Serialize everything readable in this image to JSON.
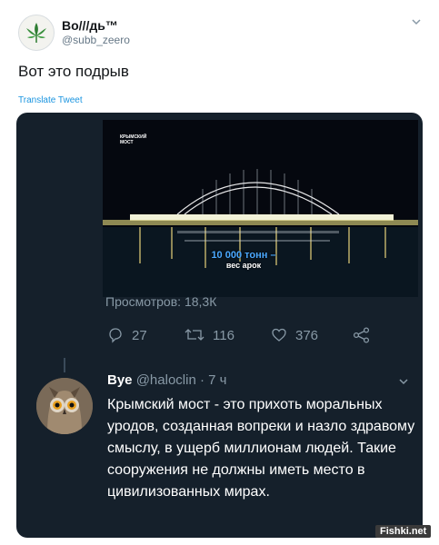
{
  "author": {
    "name": "Bo///дь™",
    "handle": "@subb_zeero"
  },
  "tweet": {
    "text": "Вот это подрыв",
    "translate_label": "Translate Tweet"
  },
  "quoted": {
    "video_logo": "КРЫМСКИЙ МОСТ",
    "caption_line1": "10 000 тонн –",
    "caption_line2": "вес арок",
    "views": "Просмотров: 18,3К",
    "replies": "27",
    "retweets": "116",
    "likes": "376",
    "reply": {
      "name": "Bye",
      "handle_time": "@haloclin · 7 ч",
      "text": "Крымский мост - это прихоть моральных уродов, созданная вопреки и назло здравому смыслу, в ущерб миллионам людей. Такие сооружения не должны иметь место в цивилизованных мирах."
    }
  },
  "watermark": "Fishki.net",
  "colors": {
    "dark_bg": "#15202b",
    "muted": "#8899a6",
    "link": "#1b95e0"
  }
}
